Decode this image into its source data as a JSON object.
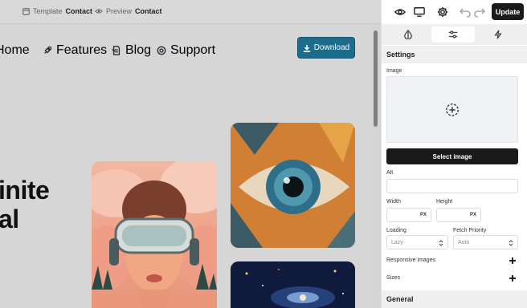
{
  "topbar": {
    "template_prefix": "Template",
    "template_name": "Contact",
    "preview_prefix": "Preview",
    "preview_name": "Contact"
  },
  "nav": {
    "items": [
      "Home",
      "Features",
      "Blog",
      "Support"
    ],
    "download": "Download"
  },
  "hero": {
    "line1": "inite",
    "line2": "al"
  },
  "panel": {
    "update": "Update",
    "settings_title": "Settings",
    "image_label": "Image",
    "select_image": "Select image",
    "alt_label": "Alt",
    "width_label": "Width",
    "height_label": "Height",
    "width_unit": "PX",
    "height_unit": "PX",
    "loading_label": "Loading",
    "loading_value": "Lazy",
    "fetch_label": "Fetch Priority",
    "fetch_value": "Auto",
    "responsive_label": "Responsive images",
    "sizes_label": "Sizes",
    "general_title": "General"
  },
  "colors": {
    "accent": "#1e6c8c",
    "dark_button": "#1a1a1a"
  }
}
